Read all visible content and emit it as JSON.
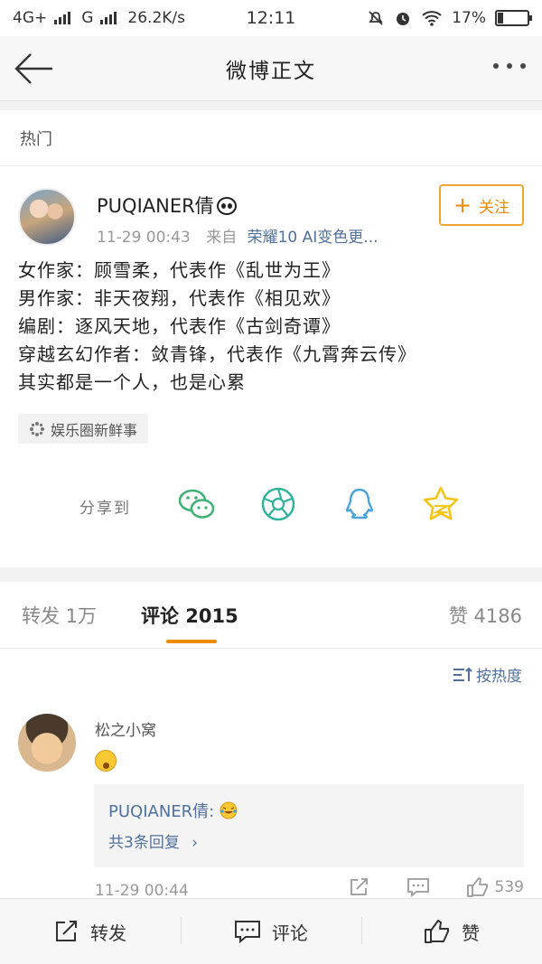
{
  "status_bar": {
    "network_left": "4G+",
    "network_right": "G",
    "speed": "26.2K/s",
    "time": "12:11",
    "battery_percent": "17%",
    "battery_level": 0.17
  },
  "nav": {
    "title": "微博正文"
  },
  "hot": {
    "label": "热门"
  },
  "post": {
    "user_name": "PUQIANER倩",
    "time": "11-29 00:43",
    "source_prefix": "来自",
    "source": "荣耀10 AI变色更...",
    "follow_label": "关注",
    "lines": [
      "女作家：顾雪柔，代表作《乱世为王》",
      "男作家：非天夜翔，代表作《相见欢》",
      "编剧：逐风天地，代表作《古剑奇谭》",
      "穿越玄幻作者：敛青锋，代表作《九霄奔云传》",
      "其实都是一个人，也是心累"
    ],
    "topic": "娱乐圈新鲜事",
    "share_label": "分享到",
    "share_targets": [
      "wechat-icon",
      "moments-icon",
      "qq-icon",
      "qzone-icon"
    ]
  },
  "tabs": {
    "repost": "转发 1万",
    "comment": "评论 2015",
    "like": "赞 4186"
  },
  "comments": {
    "sort_label": "按热度",
    "items": [
      {
        "user": "松之小窝",
        "emoji": "surprised-emoji",
        "reply_author": "PUQIANER倩:",
        "reply_emoji": "laugh-cry-emoji",
        "reply_count": "共3条回复",
        "time": "11-29 00:44",
        "likes": "539"
      }
    ]
  },
  "bottom": {
    "repost": "转发",
    "comment": "评论",
    "like": "赞"
  },
  "colors": {
    "accent": "#f28a00",
    "link": "#50719d",
    "wechat": "#3cb371",
    "qq": "#4aa3df",
    "qzone": "#f5c518"
  }
}
